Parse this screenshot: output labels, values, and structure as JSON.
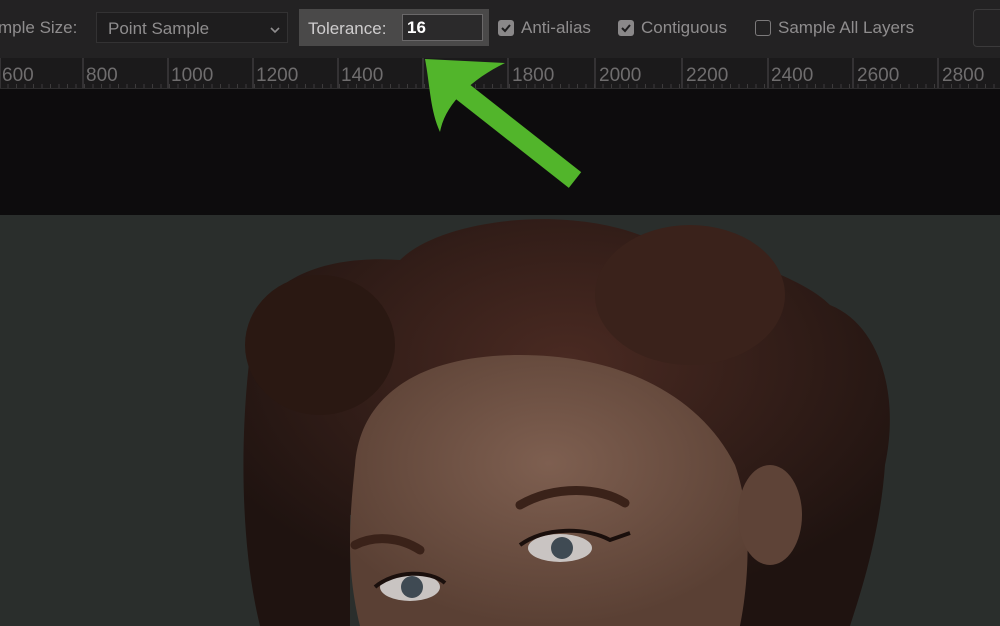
{
  "options_bar": {
    "sample_size_label": "mple Size:",
    "sample_size_value": "Point Sample",
    "tolerance_label": "Tolerance:",
    "tolerance_value": "16",
    "anti_alias_label": "Anti-alias",
    "anti_alias_checked": true,
    "contiguous_label": "Contiguous",
    "contiguous_checked": true,
    "sample_all_layers_label": "Sample All Layers",
    "sample_all_layers_checked": false
  },
  "ruler": {
    "labels": [
      "600",
      "800",
      "1000",
      "1200",
      "1400",
      "1800",
      "2000",
      "2200",
      "2400",
      "2600",
      "2800"
    ]
  },
  "colors": {
    "annotation_arrow": "#52b52b",
    "options_bar_bg": "#232223",
    "pasteboard_bg": "#0d0c0d"
  },
  "icons": {
    "select_chevron": "chevron-down-icon",
    "checkbox_check": "checkmark-icon"
  }
}
